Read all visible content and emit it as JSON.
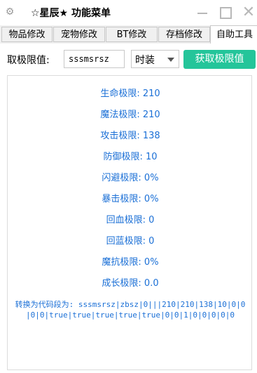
{
  "window": {
    "icon": "gear-icon",
    "title": "☆星辰★ 功能菜单",
    "controls": [
      "minimize",
      "maximize",
      "close"
    ]
  },
  "tabs": [
    {
      "label": "物品修改",
      "active": false
    },
    {
      "label": "宠物修改",
      "active": false
    },
    {
      "label": "BT修改",
      "active": false
    },
    {
      "label": "存档修改",
      "active": false
    },
    {
      "label": "自助工具",
      "active": true
    }
  ],
  "form": {
    "label": "取极限值:",
    "input_value": "sssmsrsz",
    "select_value": "时装",
    "button_label": "获取极限值",
    "button_color": "#24c59a"
  },
  "results": {
    "color": "#1a6fd6",
    "stats": [
      "生命极限: 210",
      "魔法极限: 210",
      "攻击极限: 138",
      "防御极限: 10",
      "闪避极限: 0%",
      "暴击极限: 0%",
      "回血极限: 0",
      "回蓝极限: 0",
      "魔抗极限: 0%",
      "成长极限: 0.0"
    ],
    "code": "转换为代码段为: sssmsrsz|zbsz|0|||210|210|138|10|0|0|0|0|true|true|true|true|true|0|0|1|0|0|0|0|0"
  }
}
